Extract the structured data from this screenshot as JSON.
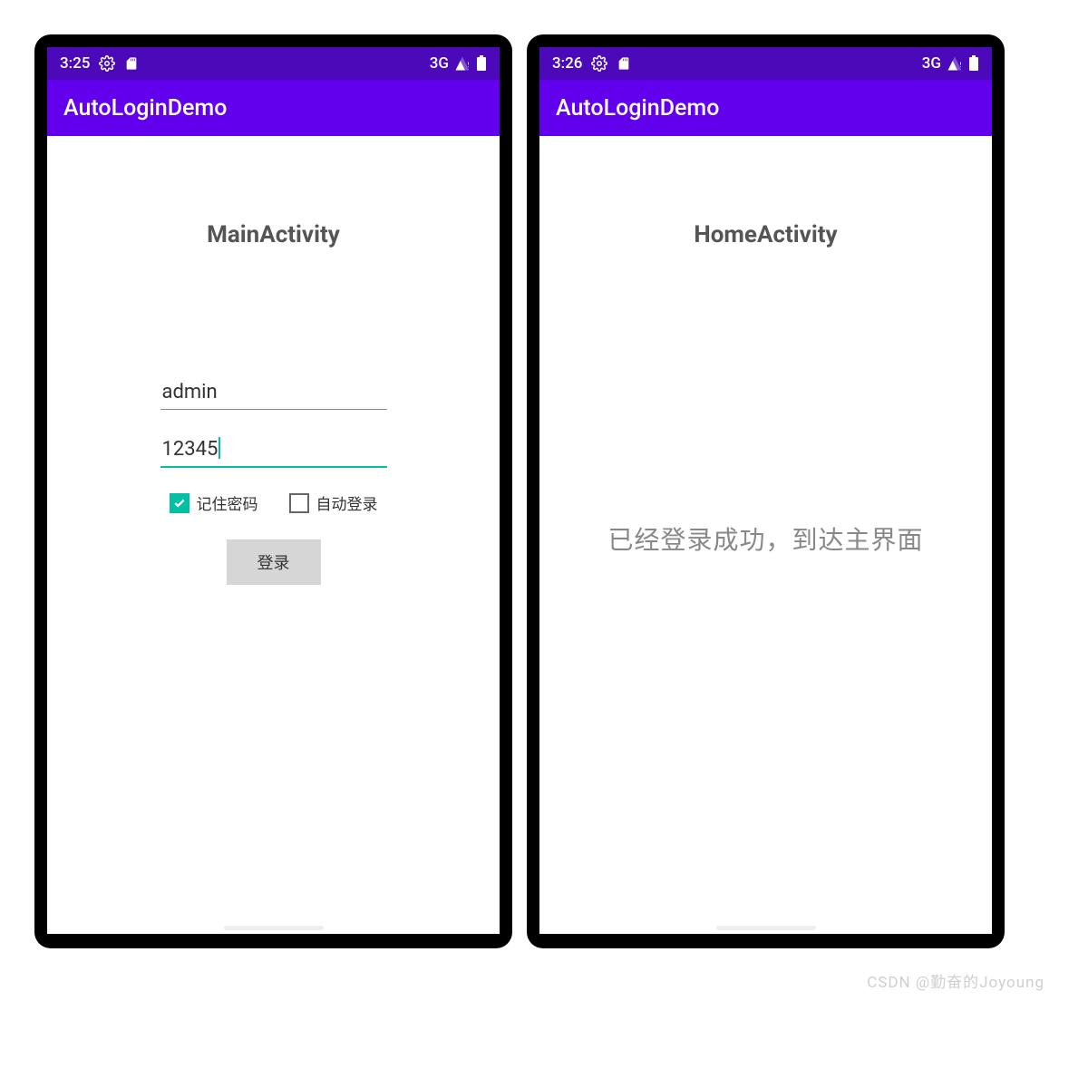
{
  "watermark": "CSDN @勤奋的Joyoung",
  "left": {
    "statusbar": {
      "time": "3:25",
      "network": "3G"
    },
    "appbar": {
      "title": "AutoLoginDemo"
    },
    "main": {
      "title": "MainActivity",
      "username": "admin",
      "password": "12345",
      "remember_label": "记住密码",
      "remember_checked": true,
      "autologin_label": "自动登录",
      "autologin_checked": false,
      "login_label": "登录"
    }
  },
  "right": {
    "statusbar": {
      "time": "3:26",
      "network": "3G"
    },
    "appbar": {
      "title": "AutoLoginDemo"
    },
    "main": {
      "title": "HomeActivity",
      "message": "已经登录成功，到达主界面"
    }
  }
}
